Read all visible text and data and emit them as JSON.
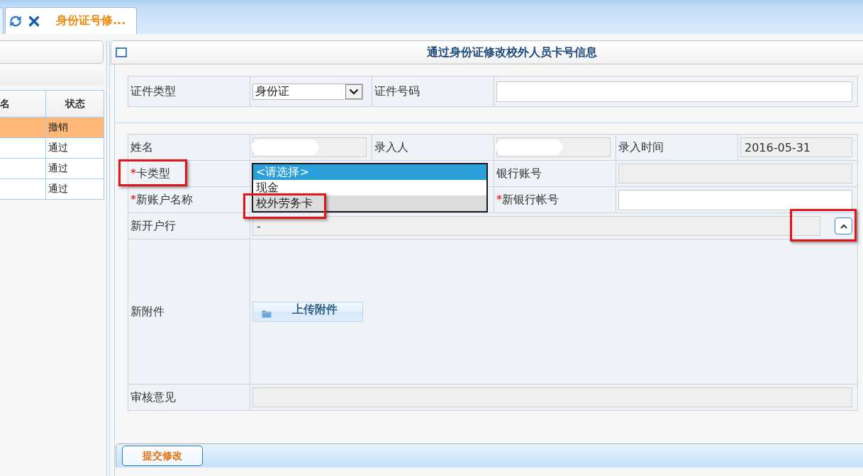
{
  "tabs": [
    {
      "selected": false
    },
    {
      "title": "身份证号修...",
      "selected": true
    }
  ],
  "left_panel": {
    "columns": [
      {
        "label": "名"
      },
      {
        "label": "状态"
      }
    ],
    "rows": [
      {
        "status": "撤销",
        "selected": true
      },
      {
        "status": "通过",
        "selected": false
      },
      {
        "status": "通过",
        "selected": false
      },
      {
        "status": "通过",
        "selected": false
      }
    ]
  },
  "form_panel": {
    "title": "通过身份证修改校外人员卡号信息",
    "id_section": {
      "fields": [
        {
          "label": "证件类型",
          "kind": "select",
          "value": "身份证",
          "redacted": false
        },
        {
          "label": "证件号码",
          "kind": "input",
          "redacted": false
        }
      ]
    },
    "card_section": {
      "rows": [
        {
          "fields": [
            {
              "label": "姓名",
              "kind": "readonly",
              "redacted": true,
              "highlighted": false
            },
            {
              "label": "录入人",
              "kind": "readonly",
              "redacted": true,
              "highlighted": false
            },
            {
              "label": "录入时间",
              "kind": "readonly",
              "value": "2016-05-31",
              "redacted": false,
              "highlighted": false
            }
          ]
        },
        {
          "fields": [
            {
              "label": "卡类型",
              "required_mark": "*",
              "kind": "listbox",
              "options": [
                {
                  "label": "<请选择>",
                  "selected": true,
                  "hovered": false,
                  "highlighted": false
                },
                {
                  "label": "现金",
                  "selected": false,
                  "hovered": false,
                  "highlighted": false
                },
                {
                  "label": "校外劳务卡",
                  "selected": false,
                  "hovered": true,
                  "highlighted": true
                }
              ],
              "redacted": false,
              "highlighted": true
            },
            {
              "label": "银行账号",
              "kind": "readonly",
              "redacted": false,
              "highlighted": false
            }
          ]
        },
        {
          "fields": [
            {
              "label": "新账户名称",
              "required_mark": "*",
              "kind": "none",
              "redacted": false,
              "highlighted": false
            },
            {
              "label": "新银行帐号",
              "required_mark": "*",
              "kind": "input",
              "redacted": false,
              "highlighted": false
            }
          ]
        },
        {
          "fields": [
            {
              "label": "新开户行",
              "kind": "picker",
              "value": "-",
              "redacted": false,
              "highlighted": false,
              "button_highlighted": true
            }
          ]
        },
        {
          "fields": [
            {
              "label": "新附件",
              "kind": "upload",
              "button": "上传附件",
              "redacted": false,
              "highlighted": false
            }
          ]
        },
        {
          "fields": [
            {
              "label": "审核意见",
              "kind": "readonly",
              "redacted": false,
              "highlighted": false
            }
          ]
        }
      ]
    },
    "submit_button": "提交修改"
  }
}
